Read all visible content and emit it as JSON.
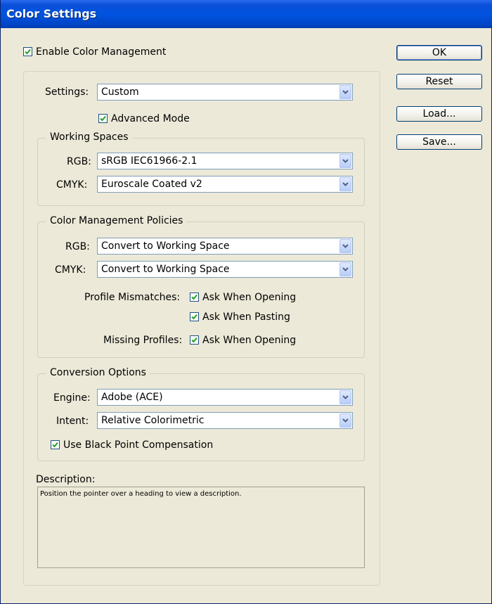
{
  "window": {
    "title": "Color Settings"
  },
  "enable_color_management": {
    "label": "Enable Color Management",
    "checked": true
  },
  "buttons": {
    "ok": "OK",
    "reset": "Reset",
    "load": "Load...",
    "save": "Save..."
  },
  "settings": {
    "label": "Settings:",
    "value": "Custom",
    "advanced_mode_label": "Advanced Mode",
    "advanced_mode_checked": true
  },
  "working_spaces": {
    "title": "Working Spaces",
    "rgb_label": "RGB:",
    "rgb_value": "sRGB IEC61966-2.1",
    "cmyk_label": "CMYK:",
    "cmyk_value": "Euroscale Coated v2"
  },
  "policies": {
    "title": "Color Management Policies",
    "rgb_label": "RGB:",
    "rgb_value": "Convert to Working Space",
    "cmyk_label": "CMYK:",
    "cmyk_value": "Convert to Working Space",
    "profile_mismatches_label": "Profile Mismatches:",
    "ask_when_opening_label": "Ask When Opening",
    "ask_when_pasting_label": "Ask When Pasting",
    "missing_profiles_label": "Missing Profiles:",
    "missing_ask_when_opening_label": "Ask When Opening"
  },
  "conversion": {
    "title": "Conversion Options",
    "engine_label": "Engine:",
    "engine_value": "Adobe (ACE)",
    "intent_label": "Intent:",
    "intent_value": "Relative Colorimetric",
    "bpc_label": "Use Black Point Compensation",
    "bpc_checked": true
  },
  "description": {
    "label": "Description:",
    "text": "Position the pointer over a heading to view a description."
  },
  "colors": {
    "titlebar": "#0053e0",
    "dialog_bg": "#ece9d8",
    "check": "#21a121"
  }
}
